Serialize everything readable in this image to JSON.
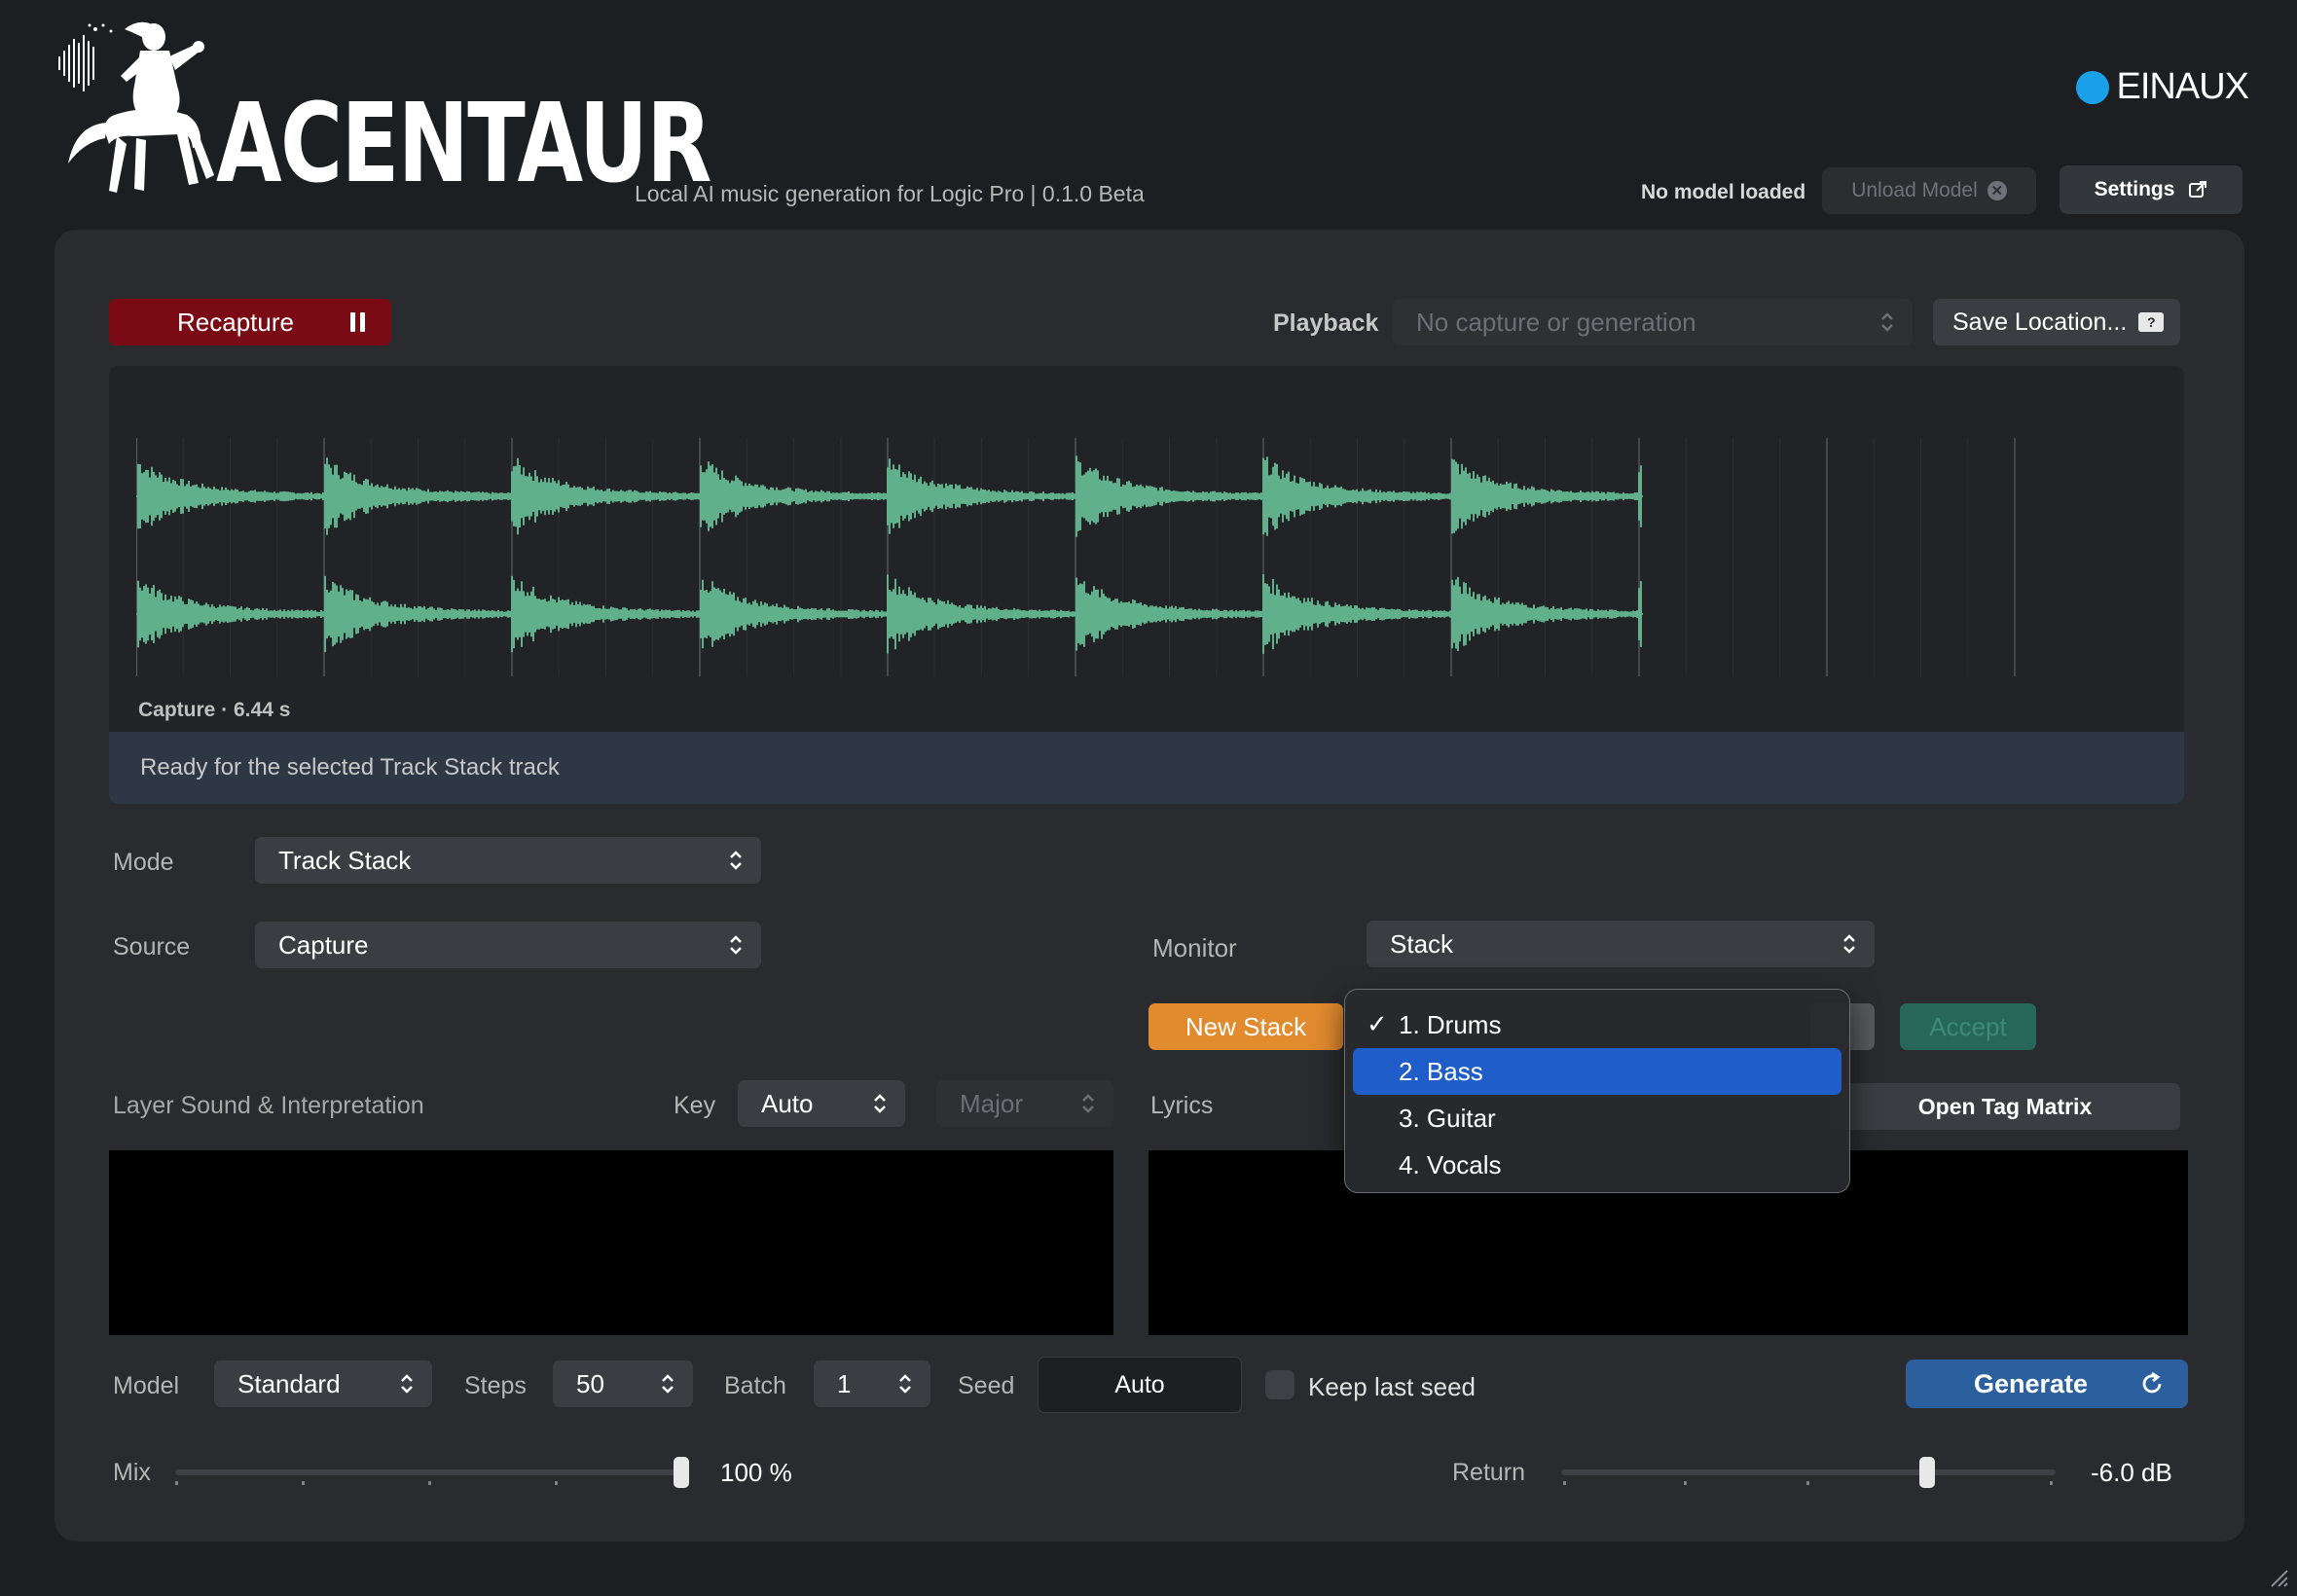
{
  "header": {
    "logo_text": "ACENTAUR",
    "tagline": "Local AI music generation for Logic Pro | 0.1.0 Beta",
    "brand": "EINAUX",
    "model_status": "No model loaded",
    "unload_label": "Unload Model",
    "settings_label": "Settings"
  },
  "capture": {
    "recapture_label": "Recapture",
    "playback_label": "Playback",
    "playback_value": "No capture or generation",
    "save_location_label": "Save Location...",
    "capture_info": "Capture · 6.44 s",
    "status_message": "Ready for the selected Track Stack track"
  },
  "controls": {
    "mode_label": "Mode",
    "mode_value": "Track Stack",
    "source_label": "Source",
    "source_value": "Capture",
    "monitor_label": "Monitor",
    "monitor_value": "Stack",
    "new_stack_label": "New Stack",
    "accept_label": "Accept",
    "layer_label": "Layer Sound & Interpretation",
    "key_label": "Key",
    "key_value": "Auto",
    "scale_value": "Major",
    "lyrics_label": "Lyrics",
    "tag_matrix_label": "Open Tag Matrix"
  },
  "generation": {
    "model_label": "Model",
    "model_value": "Standard",
    "steps_label": "Steps",
    "steps_value": "50",
    "batch_label": "Batch",
    "batch_value": "1",
    "seed_label": "Seed",
    "seed_value": "Auto",
    "keep_seed_label": "Keep last seed",
    "keep_seed_checked": false,
    "generate_label": "Generate"
  },
  "mix": {
    "mix_label": "Mix",
    "mix_value": "100 %",
    "mix_fraction": 1.0,
    "return_label": "Return",
    "return_value": "-6.0 dB",
    "return_fraction": 0.74
  },
  "track_menu": {
    "items": [
      {
        "label": "1. Drums",
        "checked": true,
        "highlighted": false
      },
      {
        "label": "2. Bass",
        "checked": false,
        "highlighted": true
      },
      {
        "label": "3. Guitar",
        "checked": false,
        "highlighted": false
      },
      {
        "label": "4. Vocals",
        "checked": false,
        "highlighted": false
      }
    ]
  },
  "colors": {
    "waveform": "#5fb08b",
    "recapture": "#7a0b14",
    "new_stack": "#e28a2e",
    "accept": "#27675a",
    "generate": "#2c5f9e",
    "menu_highlight": "#1f5dc8",
    "brand_dot": "#1aa0e8"
  }
}
